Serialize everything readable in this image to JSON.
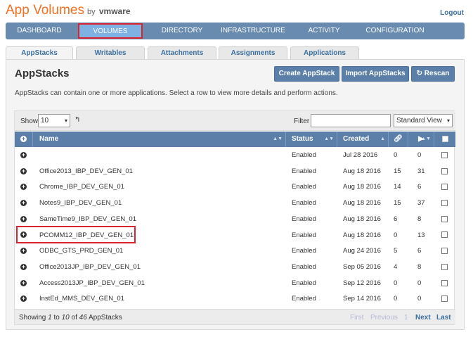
{
  "header": {
    "brand_app": "App Volumes",
    "brand_by": "by",
    "brand_vendor": "vmware",
    "logout_label": "Logout"
  },
  "nav": {
    "items": [
      {
        "label": "DASHBOARD"
      },
      {
        "label": "VOLUMES"
      },
      {
        "label": "DIRECTORY"
      },
      {
        "label": "INFRASTRUCTURE"
      },
      {
        "label": "ACTIVITY"
      },
      {
        "label": "CONFIGURATION"
      }
    ],
    "active": "VOLUMES"
  },
  "subtabs": {
    "items": [
      {
        "label": "AppStacks"
      },
      {
        "label": "Writables"
      },
      {
        "label": "Attachments"
      },
      {
        "label": "Assignments"
      },
      {
        "label": "Applications"
      }
    ],
    "active": "AppStacks"
  },
  "panel": {
    "title": "AppStacks",
    "create_label": "Create AppStack",
    "import_label": "Import AppStacks",
    "rescan_label": "Rescan",
    "description": "AppStacks can contain one or more applications. Select a row to view more details and perform actions."
  },
  "controls": {
    "show_label": "Show",
    "show_value": "10",
    "filter_label": "Filter",
    "filter_value": "",
    "view_value": "Standard View"
  },
  "table": {
    "columns": {
      "name": "Name",
      "status": "Status",
      "created": "Created"
    },
    "rows": [
      {
        "name": "",
        "status": "Enabled",
        "created": "Jul 28 2016",
        "attach": "0",
        "apps": "0"
      },
      {
        "name": "Office2013_IBP_DEV_GEN_01",
        "status": "Enabled",
        "created": "Aug 18 2016",
        "attach": "15",
        "apps": "31"
      },
      {
        "name": "Chrome_IBP_DEV_GEN_01",
        "status": "Enabled",
        "created": "Aug 18 2016",
        "attach": "14",
        "apps": "6"
      },
      {
        "name": "Notes9_IBP_DEV_GEN_01",
        "status": "Enabled",
        "created": "Aug 18 2016",
        "attach": "15",
        "apps": "37"
      },
      {
        "name": "SameTime9_IBP_DEV_GEN_01",
        "status": "Enabled",
        "created": "Aug 18 2016",
        "attach": "6",
        "apps": "8"
      },
      {
        "name": "PCOMM12_IBP_DEV_GEN_01",
        "status": "Enabled",
        "created": "Aug 18 2016",
        "attach": "0",
        "apps": "13"
      },
      {
        "name": "ODBC_GTS_PRD_GEN_01",
        "status": "Enabled",
        "created": "Aug 24 2016",
        "attach": "5",
        "apps": "6"
      },
      {
        "name": "Office2013JP_IBP_DEV_GEN_01",
        "status": "Enabled",
        "created": "Sep 05 2016",
        "attach": "4",
        "apps": "8"
      },
      {
        "name": "Access2013JP_IBP_DEV_GEN_01",
        "status": "Enabled",
        "created": "Sep 12 2016",
        "attach": "0",
        "apps": "0"
      },
      {
        "name": "InstEd_MMS_DEV_GEN_01",
        "status": "Enabled",
        "created": "Sep 14 2016",
        "attach": "0",
        "apps": "0"
      }
    ]
  },
  "footer": {
    "showing_prefix": "Showing",
    "showing_from": "1",
    "showing_to_word": "to",
    "showing_to": "10",
    "showing_of_word": "of",
    "showing_total": "46",
    "showing_suffix": "AppStacks",
    "first": "First",
    "previous": "Previous",
    "page": "1",
    "next": "Next",
    "last": "Last"
  },
  "colors": {
    "accent": "#5b7fa9",
    "brand": "#f37021",
    "highlight": "#d9232e"
  }
}
